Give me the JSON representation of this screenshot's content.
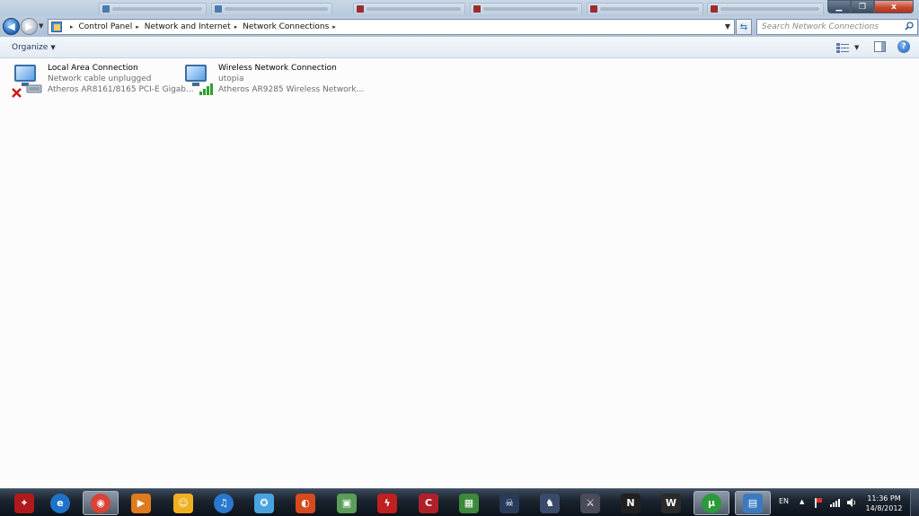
{
  "window": {
    "caption": {
      "minimize_label": "▁",
      "restore_label": "❐",
      "close_label": "x"
    }
  },
  "address_bar": {
    "root_arrow": "▸",
    "breadcrumbs": [
      {
        "label": "Control Panel"
      },
      {
        "label": "Network and Internet"
      },
      {
        "label": "Network Connections"
      }
    ],
    "search_placeholder": "Search Network Connections"
  },
  "command_bar": {
    "organize_label": "Organize"
  },
  "connections": [
    {
      "name": "Local Area Connection",
      "status": "Network cable unplugged",
      "adapter": "Atheros AR8161/8165 PCI-E Gigab...",
      "icon": "lan-disconnected-icon"
    },
    {
      "name": "Wireless Network Connection",
      "status": "utopia",
      "adapter": "Atheros AR9285 Wireless Network...",
      "icon": "wireless-connected-icon"
    }
  ],
  "taskbar": {
    "apps": [
      {
        "name": "rog-start-icon",
        "color": "#b11a1a"
      },
      {
        "name": "internet-explorer-icon",
        "color": "#1e73c9"
      },
      {
        "name": "chrome-icon",
        "color": "#d94234"
      },
      {
        "name": "media-player-icon",
        "color": "#e07a1e"
      },
      {
        "name": "messenger-icon",
        "color": "#f0b020"
      },
      {
        "name": "itunes-icon",
        "color": "#2a78d0"
      },
      {
        "name": "live-messenger-icon",
        "color": "#4aa3e0"
      },
      {
        "name": "browser-icon",
        "color": "#d64a1e"
      },
      {
        "name": "app-installer-icon",
        "color": "#5a9e5a"
      },
      {
        "name": "flash-icon",
        "color": "#c02020"
      },
      {
        "name": "cpuz-icon",
        "color": "#b0202a"
      },
      {
        "name": "gpuz-icon",
        "color": "#3a8a3a"
      },
      {
        "name": "skull-game-icon",
        "color": "#2a3a5a"
      },
      {
        "name": "soldier-game-icon",
        "color": "#3a4a6a"
      },
      {
        "name": "warrior-game-icon",
        "color": "#4a4a5a"
      },
      {
        "name": "need-for-speed-icon",
        "color": "#202020"
      },
      {
        "name": "world-of-tanks-icon",
        "color": "#2a2a2a"
      },
      {
        "name": "utorrent-icon",
        "color": "#2a9a3a"
      },
      {
        "name": "network-connections-icon",
        "color": "#3a7ac0"
      }
    ],
    "tray": {
      "language": "EN"
    },
    "clock": {
      "time": "11:36 PM",
      "date": "14/8/2012"
    }
  }
}
